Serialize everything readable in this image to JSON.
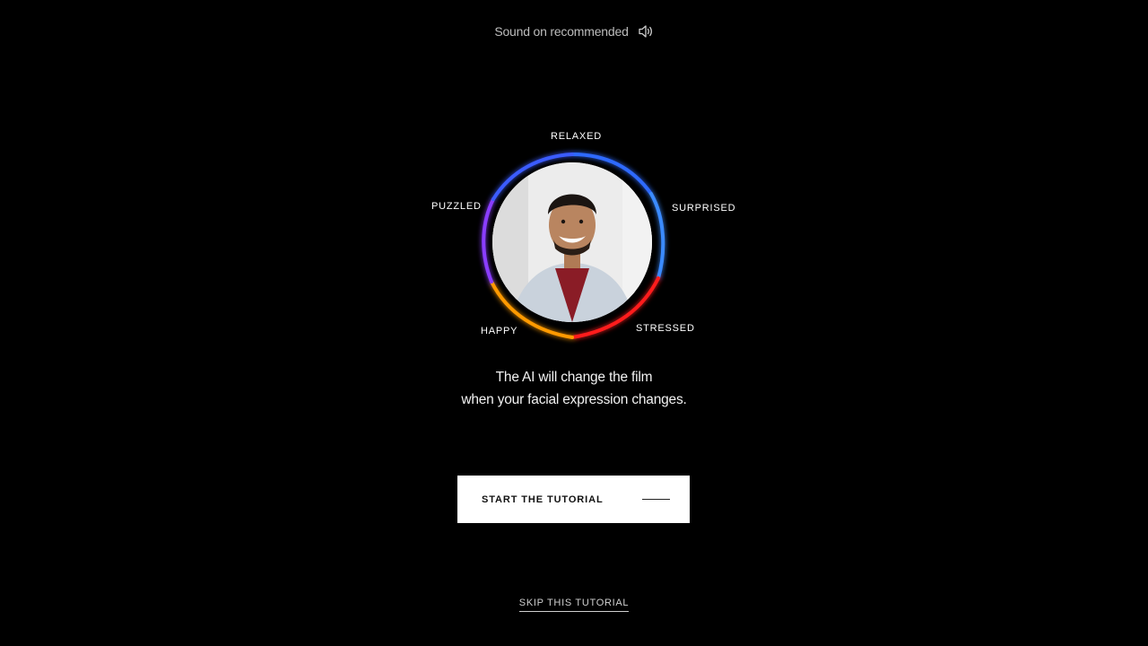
{
  "header": {
    "sound_text": "Sound on recommended",
    "sound_icon": "speaker-icon"
  },
  "emotions": {
    "relaxed": "RELAXED",
    "puzzled": "PUZZLED",
    "surprised": "SURPRISED",
    "happy": "HAPPY",
    "stressed": "STRESSED"
  },
  "message": {
    "line1": "The AI will change the film",
    "line2": "when your facial expression changes."
  },
  "actions": {
    "start_label": "START THE TUTORIAL",
    "skip_label": "SKIP THIS TUTORIAL"
  },
  "colors": {
    "background": "#000000",
    "button_bg": "#ffffff",
    "ring": [
      "#2f6bff",
      "#8a3cff",
      "#ffd400",
      "#ff7a00",
      "#ff1e1e"
    ]
  }
}
